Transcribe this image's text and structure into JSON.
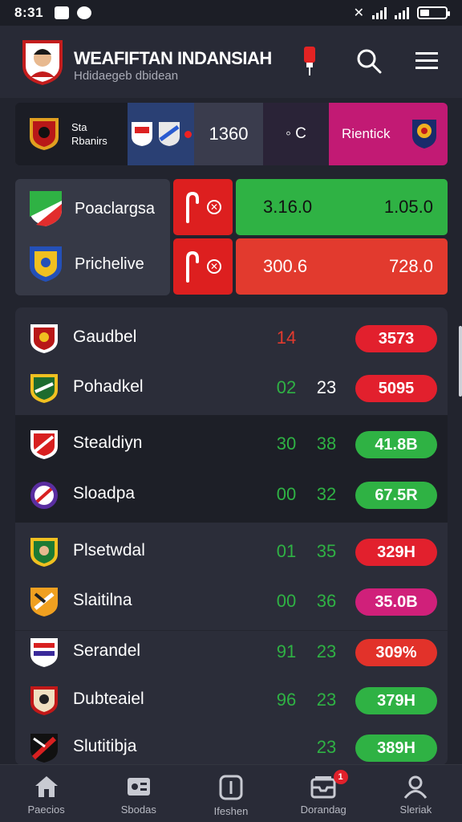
{
  "status_bar": {
    "time": "8:31"
  },
  "header": {
    "title": "WEAFIFTAN INDANSIAH",
    "subtitle": "Hdidaegeb dbidean",
    "icons": [
      "flag-icon",
      "search-icon",
      "menu-icon"
    ]
  },
  "top_strip": {
    "seg1_line1": "Sta",
    "seg1_line2": "Rbanirs",
    "score": "1360",
    "mid": "◦ C",
    "right_label": "Rientick"
  },
  "featured": [
    {
      "team": "Poaclargsa",
      "odd1": "3.16.0",
      "odd2": "1.05.0",
      "bar_color": "#2fb244"
    },
    {
      "team": "Prichelive",
      "odd1": "300.6",
      "odd2": "728.0",
      "bar_color": "#e23a2e"
    }
  ],
  "list": [
    {
      "name": "Gaudbel",
      "s1": "14",
      "s2": "",
      "s1_color": "#e23a2e",
      "pill": "3573",
      "pill_color": "#e2202d"
    },
    {
      "name": "Pohadkel",
      "s1": "02",
      "s2": "23",
      "s1_color": "#2fb244",
      "s2_color": "#ffffff",
      "pill": "5095",
      "pill_color": "#e2202d"
    },
    {
      "name": "Stealdiyn",
      "s1": "30",
      "s2": "38",
      "s1_color": "#2fb244",
      "s2_color": "#2fb244",
      "pill": "41.8B",
      "pill_color": "#2fb244"
    },
    {
      "name": "Sloadpa",
      "s1": "00",
      "s2": "32",
      "s1_color": "#2fb244",
      "s2_color": "#2fb244",
      "pill": "67.5R",
      "pill_color": "#2fb244"
    },
    {
      "name": "Plsetwdal",
      "s1": "01",
      "s2": "35",
      "s1_color": "#2fb244",
      "s2_color": "#2fb244",
      "pill": "329H",
      "pill_color": "#e2202d"
    },
    {
      "name": "Slaitilna",
      "s1": "00",
      "s2": "36",
      "s1_color": "#2fb244",
      "s2_color": "#2fb244",
      "pill": "35.0B",
      "pill_color": "#d0207a"
    },
    {
      "name": "Serandel",
      "s1": "91",
      "s2": "23",
      "s1_color": "#2fb244",
      "s2_color": "#2fb244",
      "pill": "309%",
      "pill_color": "#e2322a"
    },
    {
      "name": "Dubteaiel",
      "s1": "96",
      "s2": "23",
      "s1_color": "#2fb244",
      "s2_color": "#2fb244",
      "pill": "379H",
      "pill_color": "#2fb244"
    },
    {
      "name": "Slutitibja",
      "s1": "",
      "s2": "23",
      "s1_color": "#2fb244",
      "s2_color": "#2fb244",
      "pill": "389H",
      "pill_color": "#2fb244"
    }
  ],
  "bottom_nav": [
    {
      "label": "Paecios",
      "icon": "home-icon"
    },
    {
      "label": "Sbodas",
      "icon": "cards-icon"
    },
    {
      "label": "Ifeshen",
      "icon": "info-icon"
    },
    {
      "label": "Dorandag",
      "icon": "inbox-icon",
      "badge": "1"
    },
    {
      "label": "Sleriak",
      "icon": "profile-icon"
    }
  ],
  "colors": {
    "green": "#2fb244",
    "red": "#e2202d",
    "magenta": "#c21a74",
    "background": "#22242e"
  }
}
